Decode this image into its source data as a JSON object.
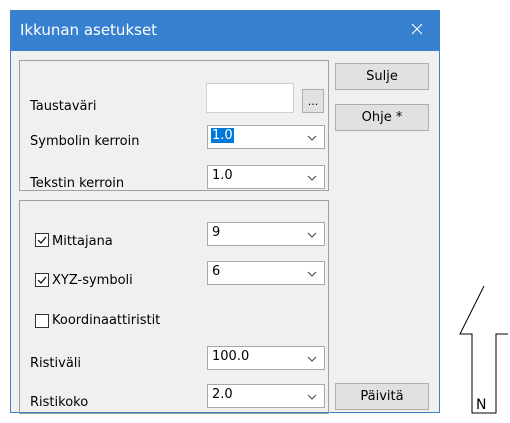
{
  "window": {
    "title": "Ikkunan asetukset",
    "close_glyph": "✕"
  },
  "group1": {
    "background": {
      "label": "Taustaväri",
      "browse_label": "..."
    },
    "symbol_factor": {
      "label": "Symbolin kerroin",
      "value": "1.0"
    },
    "text_factor": {
      "label": "Tekstin kerroin",
      "value": "1.0"
    }
  },
  "group2": {
    "measure_line": {
      "label": "Mittajana",
      "checked": true,
      "value": "9"
    },
    "xyz_symbol": {
      "label": "XYZ-symboli",
      "checked": true,
      "value": "6"
    },
    "coordinate_crosses": {
      "label": "Koordinaattiristit",
      "checked": false
    },
    "cross_interval": {
      "label": "Ristiväli",
      "value": "100.0"
    },
    "cross_size": {
      "label": "Ristikoko",
      "value": "2.0"
    }
  },
  "buttons": {
    "close": "Sulje",
    "help": "Ohje *",
    "update": "Päivitä"
  },
  "north_arrow": {
    "label": "N"
  },
  "colors": {
    "titlebar": "#3780d0",
    "dialog_bg": "#f0f0f0",
    "selection": "#0078d7"
  }
}
